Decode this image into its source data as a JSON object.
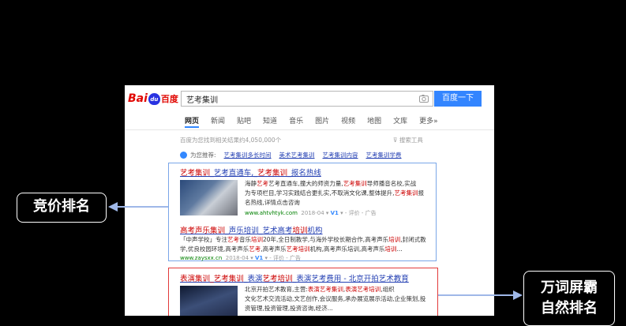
{
  "baidu": {
    "logo_text_left": "Bai",
    "logo_paw_text": "du",
    "logo_text_right": "百度",
    "search_query": "艺考集训",
    "search_button": "百度一下",
    "tabs": [
      "网页",
      "新闻",
      "贴吧",
      "知道",
      "音乐",
      "图片",
      "视频",
      "地图",
      "文库",
      "更多»"
    ],
    "result_count": "百度为您找到相关结果约4,050,000个",
    "search_tools": "搜索工具",
    "recommend_label": "为您推荐:",
    "recommend_tags": [
      "艺考集训多长时间",
      "美术艺考集训",
      "艺考集训内容",
      "艺考集训学费"
    ]
  },
  "ads": [
    {
      "title_parts": [
        "艺考集训",
        "_艺考直通车,_",
        "艺考集训",
        "_报名热线"
      ],
      "desc_lines": [
        [
          "海静",
          "艺考",
          "艺考直通车,撞大的师资力量,",
          "艺考集训",
          "导师播音名校,实战"
        ],
        [
          "为专项栏目,学习实践结合更扎实,不取消文化课,整体提升,",
          "艺考集训",
          "报"
        ],
        [
          "名热线,详情点击咨询"
        ]
      ],
      "url": "www.ahtvhtyk.com",
      "date": "2018-04",
      "v1": "V1",
      "eval": "评价",
      "ad": "广告"
    },
    {
      "title_parts": [
        "高考声乐集训",
        "_声乐培训_艺术高考",
        "培训",
        "机构"
      ],
      "desc_lines": [
        [
          "「中声学校」专注",
          "艺考",
          "音乐",
          "培训",
          "20年,全日制教学,与海外学校长期合作,高考声乐",
          "培训",
          ",封闭式教"
        ],
        [
          "学,优良校园环境,高考声乐",
          "艺考",
          ",高考声乐",
          "艺考",
          "培训",
          "机构,高考声乐培训,高考声乐",
          "培训",
          "..."
        ]
      ],
      "url": "www.zaysxx.cn",
      "date": "2018-04",
      "v1": "V1",
      "eval": "评价",
      "ad": "广告"
    }
  ],
  "organic": {
    "title_parts": [
      "表演集训",
      "_艺考集训",
      "_表演",
      "艺考培训",
      "_表演艺考费用 - 北京开拍艺术教育"
    ],
    "desc_lines": [
      [
        "北京开拍艺术教育,主营:",
        "表演艺考集训",
        ",",
        "表演艺考培训",
        ",组织"
      ],
      [
        "文化艺术交流活动,文艺创作,会议服务,承办展览展示活动,企业策划,投"
      ],
      [
        "资管理,投资管理,投资咨询,经济..."
      ]
    ]
  },
  "labels": {
    "left": "竞价排名",
    "right_line1": "万词屏霸",
    "right_line2": "自然排名"
  },
  "colors": {
    "baidu_blue": "#3385ff",
    "ad_box_border": "#7aa6e8",
    "organic_box_border": "#e23a3a",
    "arrow": "#9fb8e8"
  }
}
